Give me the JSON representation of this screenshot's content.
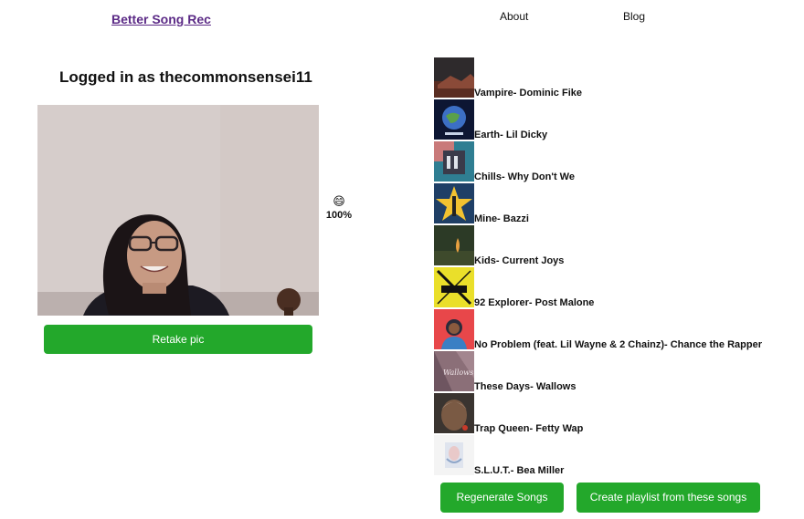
{
  "header": {
    "brand": "Better Song Rec",
    "nav": [
      {
        "label": "About"
      },
      {
        "label": "Blog"
      }
    ]
  },
  "login": {
    "title": "Logged in as thecommonsensei11"
  },
  "emotion": {
    "emoji": "😄",
    "percent": "100%"
  },
  "buttons": {
    "retake": "Retake pic",
    "regenerate": "Regenerate Songs",
    "playlist": "Create playlist from these songs"
  },
  "songs": [
    {
      "title": "Vampire- Dominic Fike"
    },
    {
      "title": "Earth- Lil Dicky"
    },
    {
      "title": "Chills- Why Don't We"
    },
    {
      "title": "Mine- Bazzi"
    },
    {
      "title": "Kids- Current Joys"
    },
    {
      "title": "92 Explorer- Post Malone"
    },
    {
      "title": "No Problem (feat. Lil Wayne & 2 Chainz)- Chance the Rapper"
    },
    {
      "title": "These Days- Wallows"
    },
    {
      "title": "Trap Queen- Fetty Wap"
    },
    {
      "title": "S.L.U.T.- Bea Miller"
    }
  ]
}
